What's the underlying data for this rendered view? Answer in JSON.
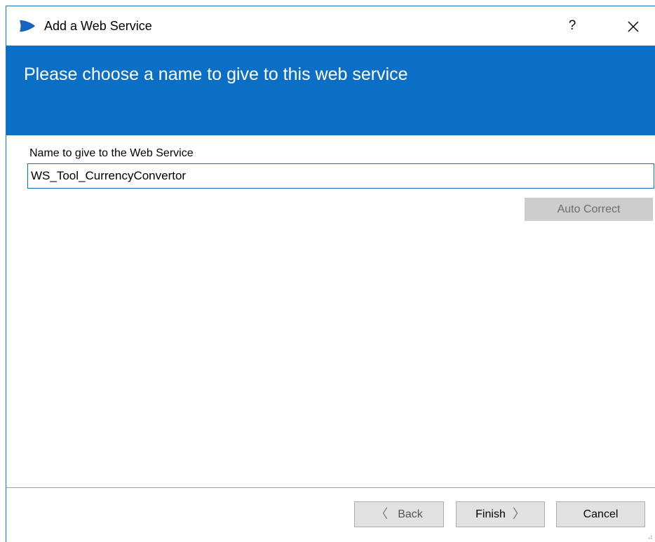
{
  "window": {
    "title": "Add a Web Service",
    "help_label": "?",
    "accent_color": "#0a6fc5"
  },
  "banner": {
    "title": "Please choose a name to give to this web service"
  },
  "form": {
    "name_label": "Name to give to the Web Service",
    "name_value": "WS_Tool_CurrencyConvertor",
    "auto_correct_label": "Auto Correct"
  },
  "footer": {
    "back_label": "Back",
    "finish_label": "Finish",
    "cancel_label": "Cancel"
  },
  "icons": {
    "app": "app-logo-icon",
    "close": "close-icon",
    "back": "chevron-left-icon",
    "finish": "chevron-right-icon"
  }
}
